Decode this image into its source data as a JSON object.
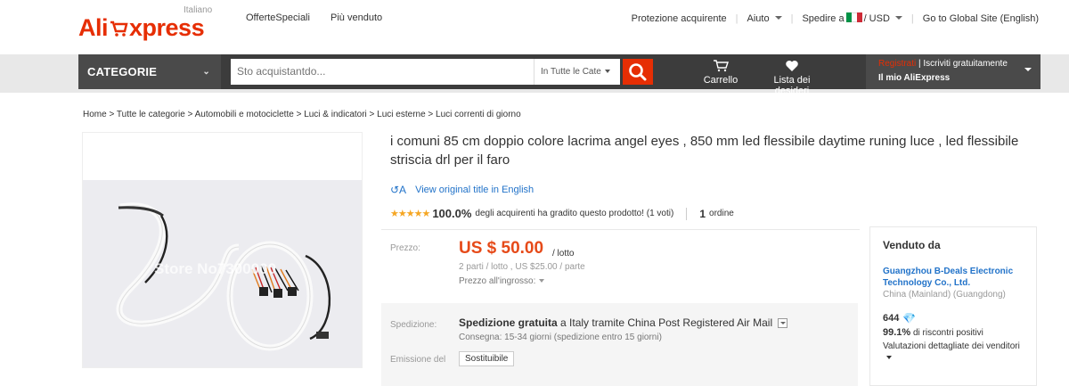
{
  "header": {
    "logo": {
      "ali": "Ali",
      "express": "xpress",
      "locale": "Italiano"
    },
    "left_links": [
      "OfferteSpeciali",
      "Più venduto"
    ],
    "right_links": {
      "protection": "Protezione acquirente",
      "help": "Aiuto",
      "ship_to": "Spedire a",
      "currency": "/ USD",
      "global": "Go to Global Site (English)"
    }
  },
  "nav": {
    "categories": "CATEGORIE",
    "search_placeholder": "Sto acquistantdo...",
    "search_category": "In Tutte le Cate",
    "cart": "Carrello",
    "wishlist": "Lista dei desideri",
    "register": "Registrati",
    "signin": "| Iscriviti gratuitamente",
    "my_account": "Il mio AliExpress"
  },
  "breadcrumb": "Home > Tutte le categorie > Automobili e motociclette > Luci & indicatori > Luci esterne > Luci correnti di giorno",
  "product": {
    "title": "i comuni 85 cm doppio colore lacrima angel eyes , 850 mm led flessibile daytime runing luce , led flessibile striscia drl per il faro",
    "view_original": "View original title in English",
    "rating_pct": "100.0%",
    "rating_text": "degli acquirenti ha gradito questo prodotto! (1 voti)",
    "orders_count": "1",
    "orders_label": "ordine",
    "watermark": "Store No7300000"
  },
  "price": {
    "label": "Prezzo:",
    "value": "US $ 50.00",
    "unit": "/ lotto",
    "bulk": "2 parti / lotto , US $25.00 / parte",
    "wholesale": "Prezzo all'ingrosso:"
  },
  "shipping": {
    "label": "Spedizione:",
    "free": "Spedizione gratuita",
    "dest": "a  Italy tramite China Post Registered Air Mail",
    "delivery": "Consegna: 15-34 giorni (spedizione entro 15 giorni)",
    "emit_label": "Emissione del",
    "emit_tag": "Sostituibile"
  },
  "seller": {
    "heading": "Venduto da",
    "name": "Guangzhou B-Deals Electronic Technology Co., Ltd.",
    "location": "China (Mainland) (Guangdong)",
    "score": "644",
    "positive_pct": "99.1%",
    "positive_text": "di riscontri positivi",
    "ratings": "Valutazioni dettagliate dei venditori"
  },
  "colors": {
    "brand": "#e62e04",
    "price": "#e64a19",
    "link": "#2273c9",
    "star": "#f5a623"
  }
}
